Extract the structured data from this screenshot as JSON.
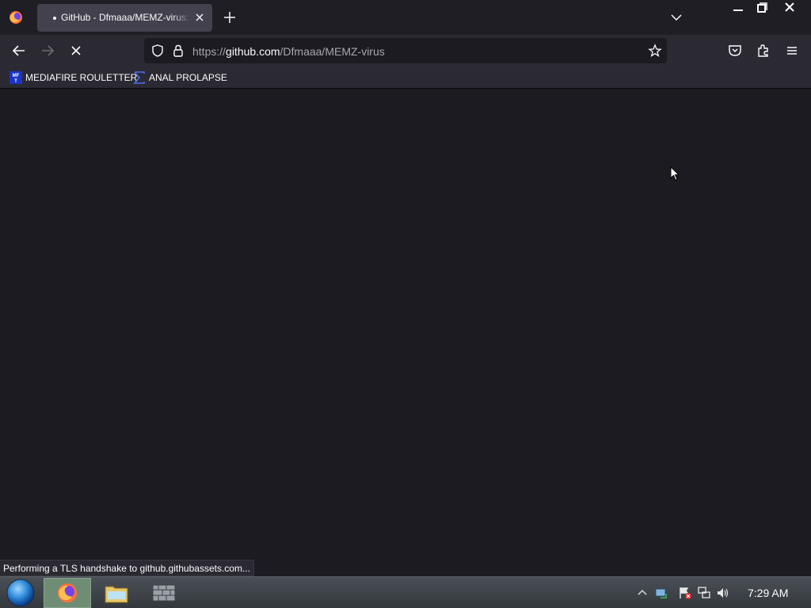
{
  "browser": {
    "tab": {
      "title": "GitHub - Dfmaaa/MEMZ-virus: MEMZ virus"
    },
    "url": {
      "scheme": "https://",
      "host": "github.com",
      "path": "/Dfmaaa/MEMZ-virus"
    },
    "bookmarks": [
      {
        "label": "MEDIAFIRE ROULETTER",
        "icon": "mft-icon"
      },
      {
        "label": "ANAL PROLAPSE",
        "icon": "sigma-icon"
      }
    ],
    "status_text": "Performing a TLS handshake to github.githubassets.com..."
  },
  "taskbar": {
    "clock": "7:29 AM",
    "apps": [
      "firefox-icon",
      "file-explorer-icon",
      "wall-icon"
    ]
  },
  "colors": {
    "chrome_bg": "#2b2a33",
    "content_bg": "#1c1b22",
    "active_tab": "#42414d",
    "text": "#fbfbfe"
  }
}
